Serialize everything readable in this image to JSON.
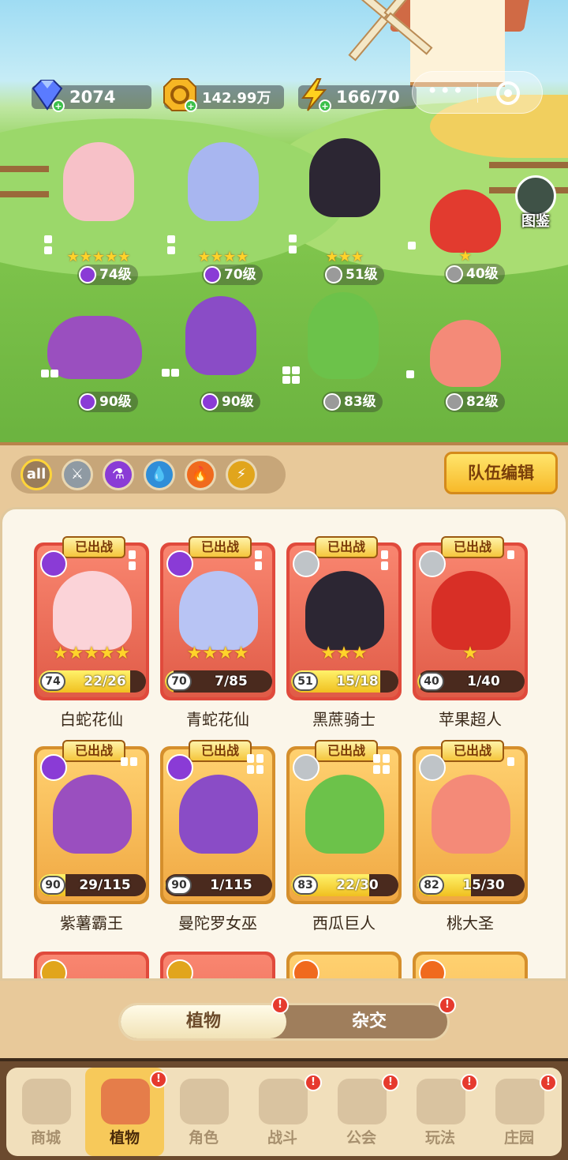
{
  "resources": {
    "gems": "2074",
    "coins": "142.99万",
    "energy": "166/70"
  },
  "capsule": {
    "more": "•••"
  },
  "codex": {
    "label": "图鉴"
  },
  "lineup": [
    {
      "level": "74级",
      "stars": "★★★★★",
      "element": "poison"
    },
    {
      "level": "70级",
      "stars": "★★★★",
      "element": "poison"
    },
    {
      "level": "51级",
      "stars": "★★★",
      "element": "sword"
    },
    {
      "level": "40级",
      "stars": "★",
      "element": "sword"
    },
    {
      "level": "90级",
      "stars": "",
      "element": "poison"
    },
    {
      "level": "90级",
      "stars": "",
      "element": "poison"
    },
    {
      "level": "83级",
      "stars": "",
      "element": "sword"
    },
    {
      "level": "82级",
      "stars": "",
      "element": "sword"
    }
  ],
  "filters": {
    "all": "all",
    "items": [
      "sword-icon",
      "poison-icon",
      "water-icon",
      "fire-icon",
      "lightning-icon"
    ]
  },
  "team_edit": "队伍编辑",
  "deployed_tag": "已出战",
  "cards": [
    {
      "name": "白蛇花仙",
      "level": "74",
      "progress": "22/26",
      "ratio": 0.85,
      "stars": "★★★★★",
      "rarity": "red"
    },
    {
      "name": "青蛇花仙",
      "level": "70",
      "progress": "7/85",
      "ratio": 0.08,
      "stars": "★★★★",
      "rarity": "red"
    },
    {
      "name": "黑蔗骑士",
      "level": "51",
      "progress": "15/18",
      "ratio": 0.83,
      "stars": "★★★",
      "rarity": "red"
    },
    {
      "name": "苹果超人",
      "level": "40",
      "progress": "1/40",
      "ratio": 0.03,
      "stars": "★",
      "rarity": "red"
    },
    {
      "name": "紫薯霸王",
      "level": "90",
      "progress": "29/115",
      "ratio": 0.25,
      "stars": "",
      "rarity": "gold"
    },
    {
      "name": "曼陀罗女巫",
      "level": "90",
      "progress": "1/115",
      "ratio": 0.01,
      "stars": "",
      "rarity": "gold"
    },
    {
      "name": "西瓜巨人",
      "level": "83",
      "progress": "22/30",
      "ratio": 0.73,
      "stars": "",
      "rarity": "gold"
    },
    {
      "name": "桃大圣",
      "level": "82",
      "progress": "15/30",
      "ratio": 0.5,
      "stars": "",
      "rarity": "gold"
    }
  ],
  "tabs": {
    "plants": "植物",
    "hybrid": "杂交"
  },
  "nav": [
    {
      "label": "商城",
      "badge": false
    },
    {
      "label": "植物",
      "badge": true
    },
    {
      "label": "角色",
      "badge": false
    },
    {
      "label": "战斗",
      "badge": true
    },
    {
      "label": "公会",
      "badge": true
    },
    {
      "label": "玩法",
      "badge": true
    },
    {
      "label": "庄园",
      "badge": true
    }
  ],
  "colors": {
    "accent": "#f7c95a",
    "red_card": "#e04a3c",
    "gold_card": "#d58f2c",
    "badge": "#e63a2e"
  }
}
